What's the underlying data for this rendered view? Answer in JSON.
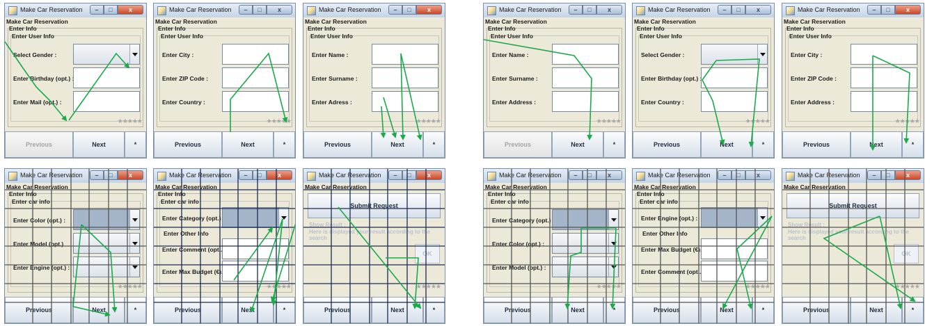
{
  "colors": {
    "arrow": "#1aaa4a",
    "grid_dark": "#1b2a50",
    "grid_gray": "#555555"
  },
  "icons": [
    "app-icon",
    "minimize-icon",
    "maximize-icon",
    "close-icon",
    "combo-arrow-icon",
    "star-rating-icon"
  ],
  "common": {
    "window_title": "Make Car Reservation",
    "app_heading": "Make Car Reservation",
    "enter_info": "Enter Info",
    "enter_user_info": "Enter User Info",
    "enter_car_info": "Enter car info",
    "enter_other_info": "Enter Other Info",
    "previous": "Previous",
    "next": "Next",
    "star": "*",
    "stars": "★★★★★",
    "minimize": "–",
    "maximize": "□",
    "close": "x",
    "submit": "Submit Request",
    "show_result": "Show Result :",
    "result_desc": "Here is displayed your result according to the search",
    "ok": "OK"
  },
  "fields": {
    "gender": "Select Gender :",
    "birthday": "Enter Birthday (opt.) :",
    "mail": "Enter Mail (opt.) :",
    "city": "Enter City :",
    "zip": "Enter ZIP Code :",
    "country": "Enter Country :",
    "name": "Enter Name :",
    "surname": "Enter Surname :",
    "adress": "Enter Adress :",
    "address": "Enter Address :",
    "color": "Enter Color (opt.) :",
    "model": "Enter Model (opt.)",
    "engine_colon": "Enter Engine (opt.) :",
    "category": "Enter Category (opt.) :",
    "comment": "Enter Comment (opt....",
    "budget": "Enter Max Budget (€)...",
    "color2": "Enter Color (opt.) :",
    "model2": "Enter Model (opt.) :",
    "engine2": "Enter Engine (opt.) :"
  }
}
